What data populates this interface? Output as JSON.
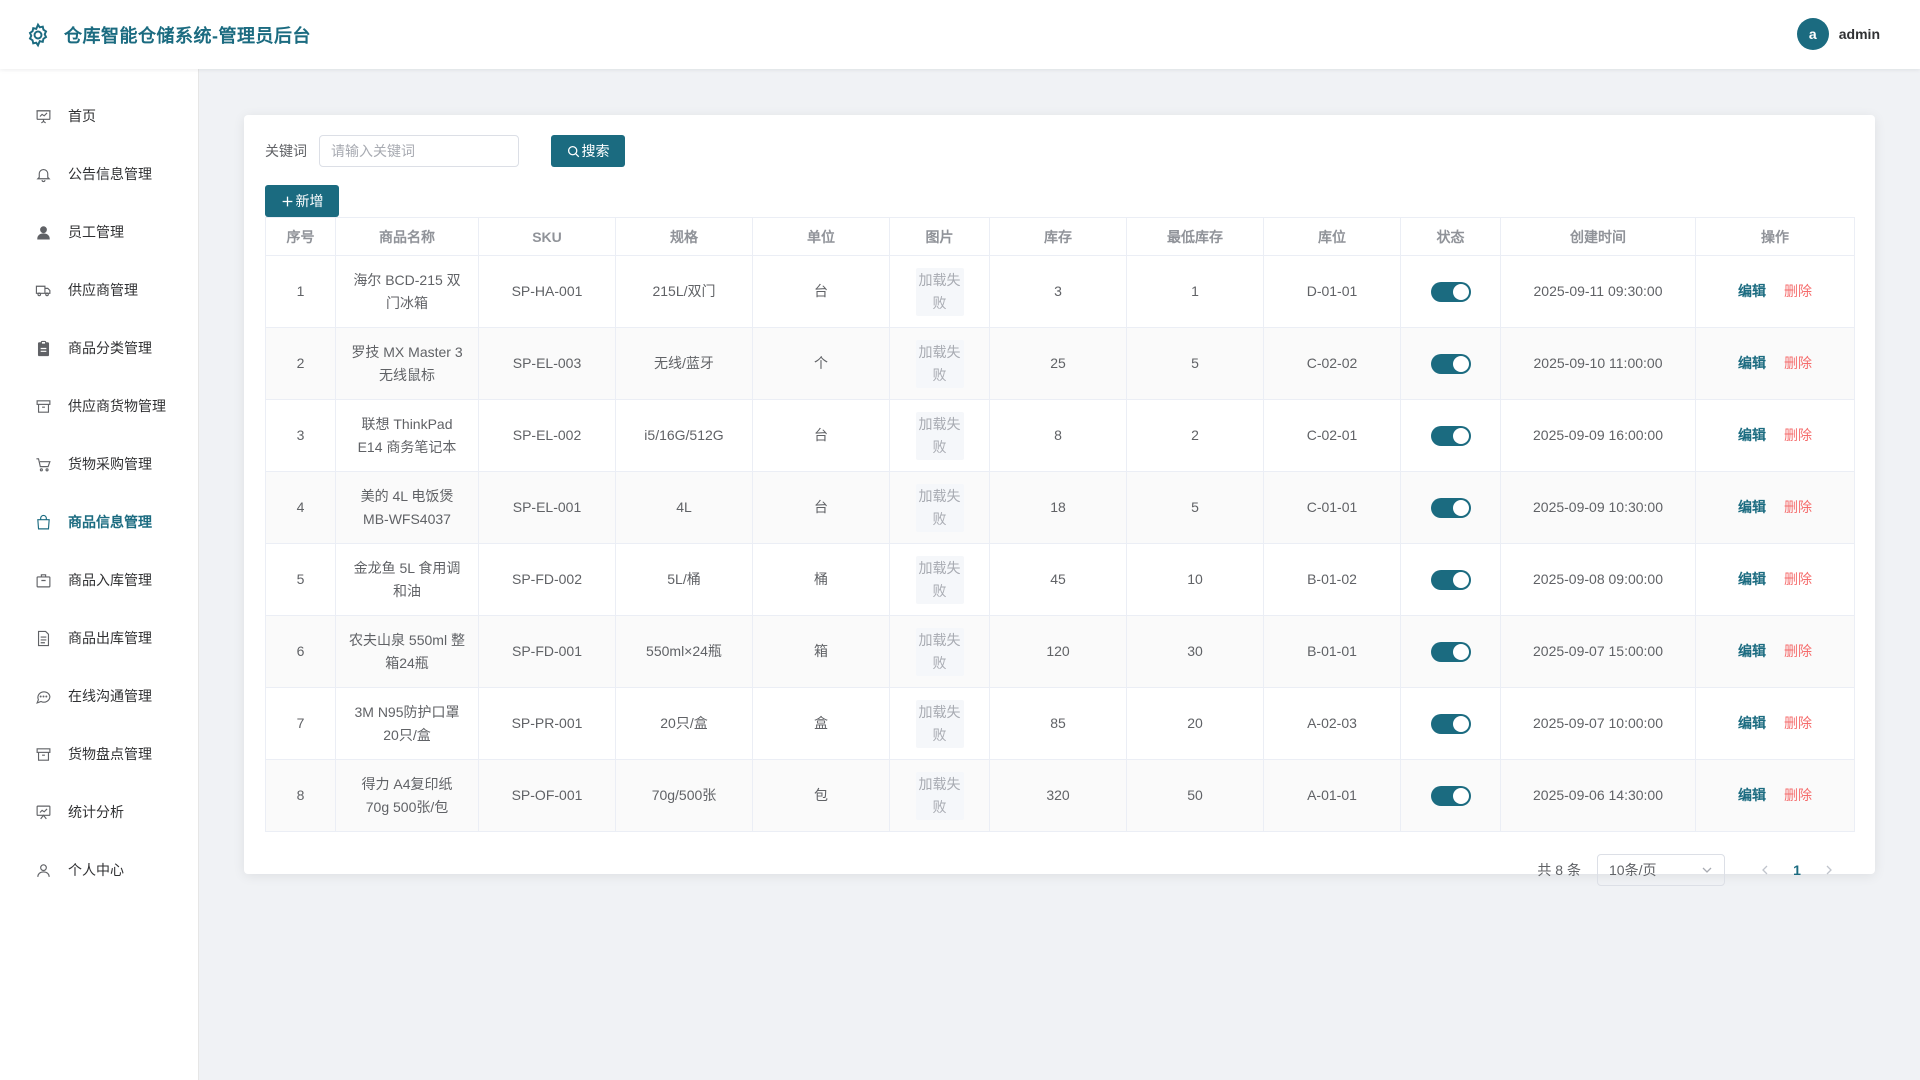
{
  "header": {
    "title": "仓库智能仓储系统-管理员后台",
    "avatar_letter": "a",
    "username": "admin"
  },
  "sidebar": {
    "items": [
      {
        "label": "首页",
        "icon": "presentation-icon"
      },
      {
        "label": "公告信息管理",
        "icon": "bell-icon"
      },
      {
        "label": "员工管理",
        "icon": "user-filled-icon"
      },
      {
        "label": "供应商管理",
        "icon": "van-icon"
      },
      {
        "label": "商品分类管理",
        "icon": "clipboard-icon"
      },
      {
        "label": "供应商货物管理",
        "icon": "box-icon"
      },
      {
        "label": "货物采购管理",
        "icon": "cart-icon"
      },
      {
        "label": "商品信息管理",
        "icon": "bag-icon"
      },
      {
        "label": "商品入库管理",
        "icon": "suitcase-icon"
      },
      {
        "label": "商品出库管理",
        "icon": "document-icon"
      },
      {
        "label": "在线沟通管理",
        "icon": "chat-icon"
      },
      {
        "label": "货物盘点管理",
        "icon": "box-icon"
      },
      {
        "label": "统计分析",
        "icon": "chart-board-icon"
      },
      {
        "label": "个人中心",
        "icon": "user-icon"
      }
    ],
    "active_index": 7
  },
  "search": {
    "label": "关键词",
    "placeholder": "请输入关键词",
    "value": "",
    "button_label": "搜索"
  },
  "toolbar": {
    "add_label": "新增"
  },
  "table": {
    "columns": [
      "序号",
      "商品名称",
      "SKU",
      "规格",
      "单位",
      "图片",
      "库存",
      "最低库存",
      "库位",
      "状态",
      "创建时间",
      "操作"
    ],
    "rows": [
      {
        "index": "1",
        "name": "海尔 BCD-215 双门冰箱",
        "sku": "SP-HA-001",
        "spec": "215L/双门",
        "unit": "台",
        "image": "加载失败",
        "stock": "3",
        "min_stock": "1",
        "location": "D-01-01",
        "status_on": true,
        "created": "2025-09-11 09:30:00"
      },
      {
        "index": "2",
        "name": "罗技 MX Master 3 无线鼠标",
        "sku": "SP-EL-003",
        "spec": "无线/蓝牙",
        "unit": "个",
        "image": "加载失败",
        "stock": "25",
        "min_stock": "5",
        "location": "C-02-02",
        "status_on": true,
        "created": "2025-09-10 11:00:00"
      },
      {
        "index": "3",
        "name": "联想 ThinkPad E14 商务笔记本",
        "sku": "SP-EL-002",
        "spec": "i5/16G/512G",
        "unit": "台",
        "image": "加载失败",
        "stock": "8",
        "min_stock": "2",
        "location": "C-02-01",
        "status_on": true,
        "created": "2025-09-09 16:00:00"
      },
      {
        "index": "4",
        "name": "美的 4L 电饭煲 MB-WFS4037",
        "sku": "SP-EL-001",
        "spec": "4L",
        "unit": "台",
        "image": "加载失败",
        "stock": "18",
        "min_stock": "5",
        "location": "C-01-01",
        "status_on": true,
        "created": "2025-09-09 10:30:00"
      },
      {
        "index": "5",
        "name": "金龙鱼 5L 食用调和油",
        "sku": "SP-FD-002",
        "spec": "5L/桶",
        "unit": "桶",
        "image": "加载失败",
        "stock": "45",
        "min_stock": "10",
        "location": "B-01-02",
        "status_on": true,
        "created": "2025-09-08 09:00:00"
      },
      {
        "index": "6",
        "name": "农夫山泉 550ml 整箱24瓶",
        "sku": "SP-FD-001",
        "spec": "550ml×24瓶",
        "unit": "箱",
        "image": "加载失败",
        "stock": "120",
        "min_stock": "30",
        "location": "B-01-01",
        "status_on": true,
        "created": "2025-09-07 15:00:00"
      },
      {
        "index": "7",
        "name": "3M N95防护口罩 20只/盒",
        "sku": "SP-PR-001",
        "spec": "20只/盒",
        "unit": "盒",
        "image": "加载失败",
        "stock": "85",
        "min_stock": "20",
        "location": "A-02-03",
        "status_on": true,
        "created": "2025-09-07 10:00:00"
      },
      {
        "index": "8",
        "name": "得力 A4复印纸 70g 500张/包",
        "sku": "SP-OF-001",
        "spec": "70g/500张",
        "unit": "包",
        "image": "加载失败",
        "stock": "320",
        "min_stock": "50",
        "location": "A-01-01",
        "status_on": true,
        "created": "2025-09-06 14:30:00"
      }
    ],
    "edit_label": "编辑",
    "delete_label": "删除"
  },
  "pagination": {
    "total_text": "共 8 条",
    "page_size": "10条/页",
    "current_page": "1"
  },
  "colors": {
    "primary": "#1b6b80",
    "danger": "#f56c6c",
    "background": "#f0f2f5"
  }
}
